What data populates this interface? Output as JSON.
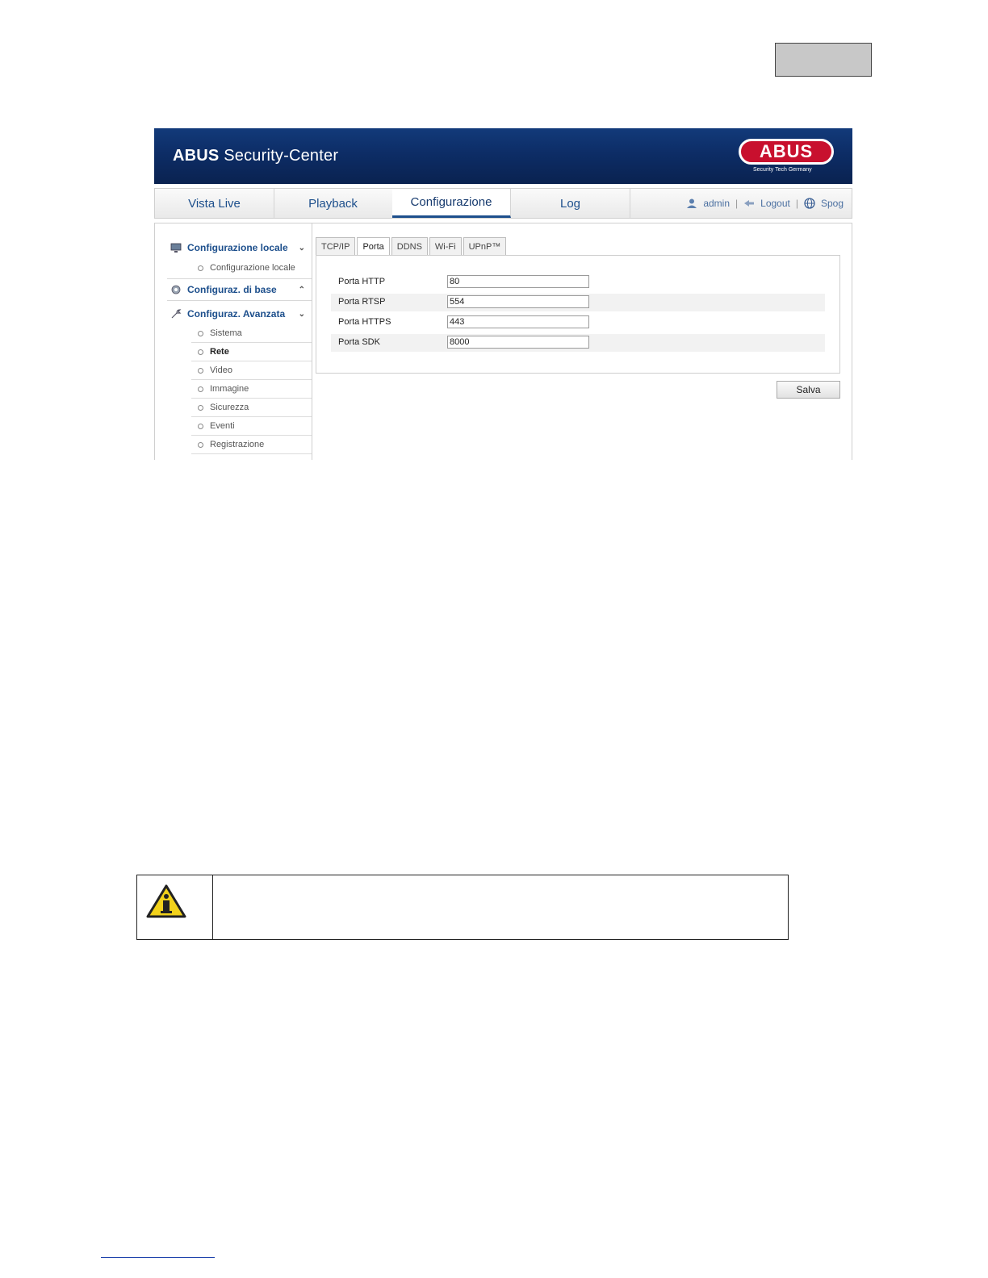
{
  "header": {
    "brand_bold": "ABUS",
    "brand_rest": " Security-Center",
    "logo_text": "ABUS",
    "logo_tagline": "Security Tech Germany"
  },
  "nav": {
    "tabs": [
      {
        "label": "Vista Live"
      },
      {
        "label": "Playback"
      },
      {
        "label": "Configurazione"
      },
      {
        "label": "Log"
      }
    ],
    "active_tab": "Configurazione",
    "user": "admin",
    "logout": "Logout",
    "language": "Spog"
  },
  "sidebar": {
    "sections": [
      {
        "label": "Configurazione locale",
        "icon": "monitor-icon",
        "state": "expanded"
      },
      {
        "label": "Configuraz. di base",
        "icon": "gear-icon",
        "state": "collapsed"
      },
      {
        "label": "Configuraz. Avanzata",
        "icon": "wrench-icon",
        "state": "expanded"
      }
    ],
    "local_items": [
      "Configurazione locale"
    ],
    "advanced_items": [
      "Sistema",
      "Rete",
      "Video",
      "Immagine",
      "Sicurezza",
      "Eventi",
      "Registrazione"
    ],
    "active_item": "Rete"
  },
  "tabs": [
    "TCP/IP",
    "Porta",
    "DDNS",
    "Wi-Fi",
    "UPnP™"
  ],
  "active_tab": "Porta",
  "ports": [
    {
      "label": "Porta HTTP",
      "value": "80"
    },
    {
      "label": "Porta RTSP",
      "value": "554"
    },
    {
      "label": "Porta HTTPS",
      "value": "443"
    },
    {
      "label": "Porta SDK",
      "value": "8000"
    }
  ],
  "save_label": "Salva",
  "colors": {
    "accent": "#1d4f8c",
    "banner": "#0d2d66",
    "logo_red": "#c8102e",
    "warning_yellow": "#f2d21b"
  }
}
